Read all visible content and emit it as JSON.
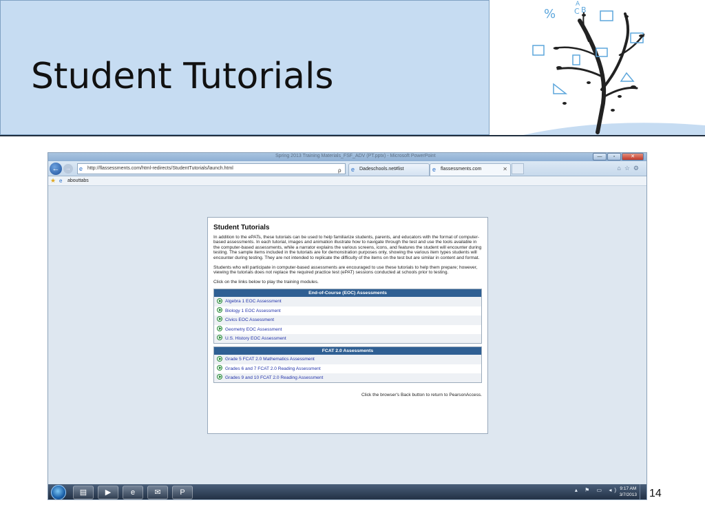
{
  "slide": {
    "title": "Student Tutorials",
    "page_number": "14"
  },
  "tree_art": {
    "symbols": [
      "%",
      "A",
      "C",
      "B"
    ]
  },
  "browser": {
    "window_title": "Spring 2013 Training Materials_FSF_ADV (PT.pptx) - Microsoft PowerPoint",
    "address_url": "http://flassessments.com/html-redirects/StudentTutorials/launch.html",
    "address_tools": "ρ ▾ ≧ C ✕",
    "tabs": [
      {
        "label": "Dadeschools.net#list"
      },
      {
        "label": "flassessments.com"
      }
    ],
    "tab_close": "✕",
    "favorites_label": "abouttabs",
    "win_controls": {
      "minimize": "—",
      "maximize": "▫",
      "close": "✕"
    }
  },
  "panel": {
    "heading": "Student Tutorials",
    "paragraph1": "In addition to the ePATs, these tutorials can be used to help familiarize students, parents, and educators with the format of computer-based assessments. In each tutorial, images and animation illustrate how to navigate through the test and use the tools available in the computer-based assessments, while a narrator explains the various screens, icons, and features the student will encounter during testing. The sample items included in the tutorials are for demonstration purposes only, showing the various item types students will encounter during testing. They are not intended to replicate the difficulty of the items on the test but are similar in content and format.",
    "paragraph2": "Students who will participate in computer-based assessments are encouraged to use these tutorials to help them prepare; however, viewing the tutorials does not replace the required practice test (ePAT) sessions conducted at schools prior to testing.",
    "paragraph3": "Click on the links below to play the training modules.",
    "eoc": {
      "heading": "End-of-Course (EOC) Assessments",
      "links": [
        "Algebra 1 EOC Assessment",
        "Biology 1 EOC Assessment",
        "Civics EOC Assessment",
        "Geometry EOC Assessment",
        "U.S. History EOC Assessment"
      ]
    },
    "fcat": {
      "heading": "FCAT 2.0 Assessments",
      "links": [
        "Grade 5 FCAT 2.0 Mathematics Assessment",
        "Grades 6 and 7 FCAT 2.0 Reading Assessment",
        "Grades 9 and 10 FCAT 2.0 Reading Assessment"
      ]
    },
    "back_note": "Click the browser's Back button to return to PearsonAccess."
  },
  "taskbar": {
    "time": "9:17 AM",
    "date": "3/7/2013",
    "tray": "▴ ⚑ ▭ ◂)"
  }
}
